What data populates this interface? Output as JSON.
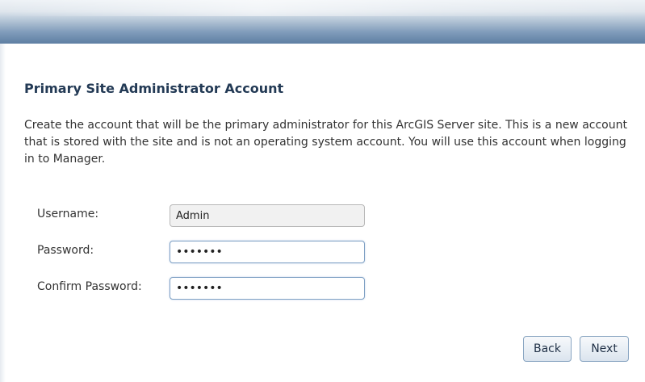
{
  "section": {
    "title": "Primary Site Administrator Account",
    "description": "Create the account that will be the primary administrator for this ArcGIS Server site. This is a new account that is stored with the site and is not an operating system account. You will use this account when logging in to Manager."
  },
  "form": {
    "username": {
      "label": "Username:",
      "value": "Admin"
    },
    "password": {
      "label": "Password:",
      "value": "•••••••"
    },
    "confirm_password": {
      "label": "Confirm Password:",
      "value": "•••••••"
    }
  },
  "buttons": {
    "back": "Back",
    "next": "Next"
  }
}
